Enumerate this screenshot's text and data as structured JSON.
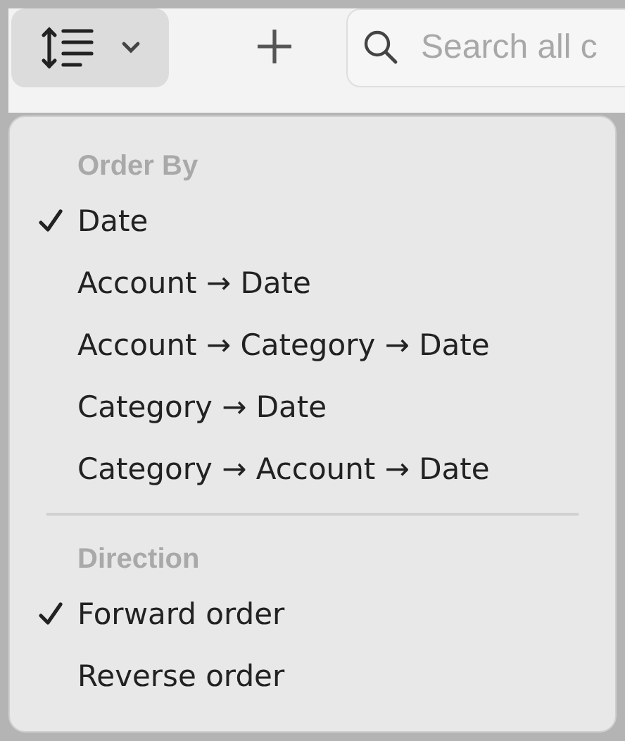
{
  "toolbar": {
    "search": {
      "placeholder": "Search all c"
    }
  },
  "menu": {
    "sections": [
      {
        "title": "Order By",
        "items": [
          {
            "label": "Date",
            "selected": true
          },
          {
            "label": "Account → Date",
            "selected": false
          },
          {
            "label": "Account → Category → Date",
            "selected": false
          },
          {
            "label": "Category → Date",
            "selected": false
          },
          {
            "label": "Category → Account → Date",
            "selected": false
          }
        ]
      },
      {
        "title": "Direction",
        "items": [
          {
            "label": "Forward order",
            "selected": true
          },
          {
            "label": "Reverse order",
            "selected": false
          }
        ]
      }
    ]
  }
}
